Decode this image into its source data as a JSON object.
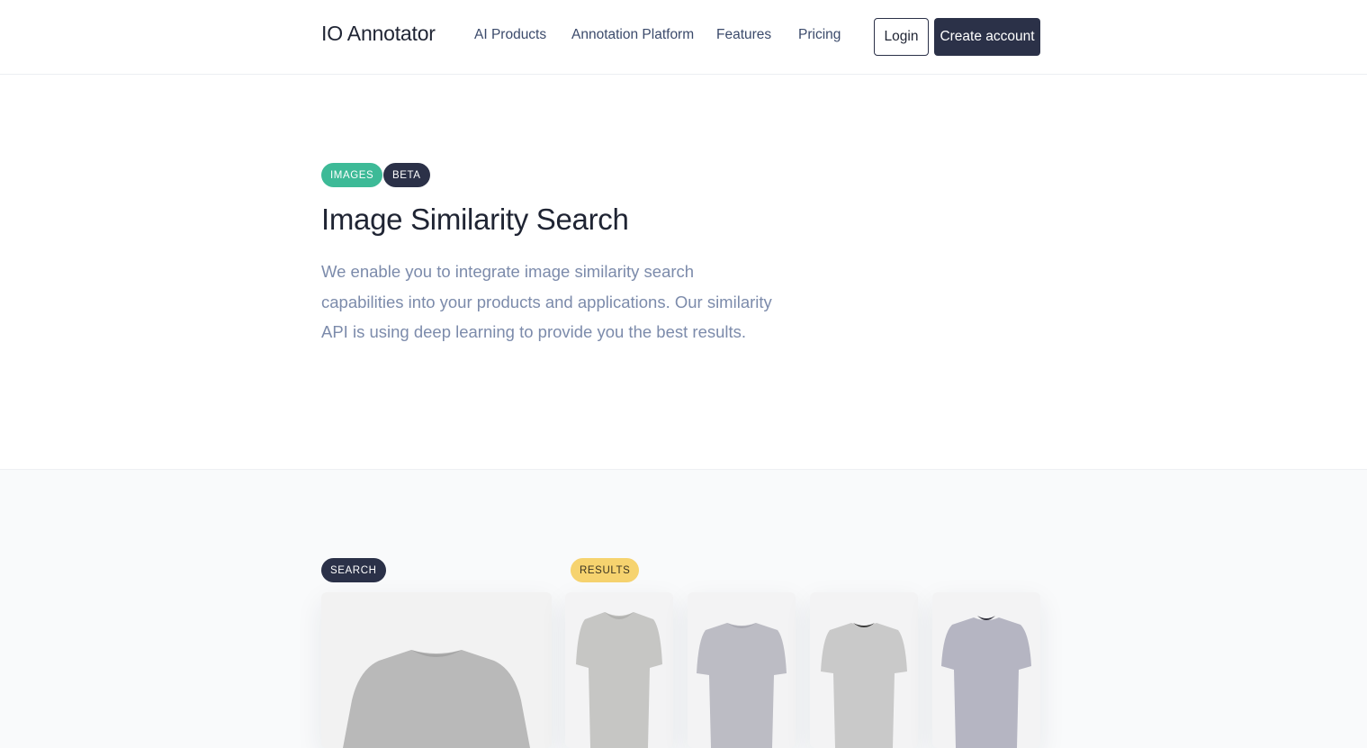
{
  "header": {
    "brand": "IO Annotator",
    "nav": [
      "AI Products",
      "Annotation Platform",
      "Features",
      "Pricing"
    ],
    "login_label": "Login",
    "create_account_label": "Create account"
  },
  "hero": {
    "badges": [
      "IMAGES",
      "BETA"
    ],
    "title": "Image Similarity Search",
    "description": "We enable you to integrate image similarity search capabilities into your products and applications. Our similarity API is using deep learning to provide you the best results."
  },
  "demo": {
    "search_badge": "SEARCH",
    "results_badge": "RESULTS"
  },
  "colors": {
    "primary_dark": "#2b3148",
    "images_badge": "#3dba97",
    "results_badge": "#f6d36f",
    "body_text": "#7c8bab"
  },
  "icons": [
    "tshirt-image"
  ]
}
